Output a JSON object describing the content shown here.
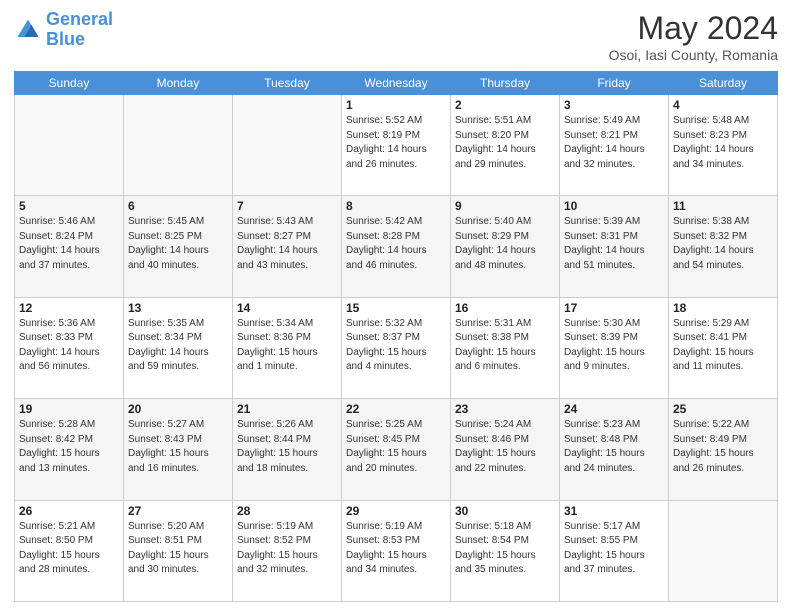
{
  "header": {
    "logo_line1": "General",
    "logo_line2": "Blue",
    "month_year": "May 2024",
    "location": "Osoi, Iasi County, Romania"
  },
  "weekdays": [
    "Sunday",
    "Monday",
    "Tuesday",
    "Wednesday",
    "Thursday",
    "Friday",
    "Saturday"
  ],
  "weeks": [
    [
      {
        "day": "",
        "info": ""
      },
      {
        "day": "",
        "info": ""
      },
      {
        "day": "",
        "info": ""
      },
      {
        "day": "1",
        "info": "Sunrise: 5:52 AM\nSunset: 8:19 PM\nDaylight: 14 hours\nand 26 minutes."
      },
      {
        "day": "2",
        "info": "Sunrise: 5:51 AM\nSunset: 8:20 PM\nDaylight: 14 hours\nand 29 minutes."
      },
      {
        "day": "3",
        "info": "Sunrise: 5:49 AM\nSunset: 8:21 PM\nDaylight: 14 hours\nand 32 minutes."
      },
      {
        "day": "4",
        "info": "Sunrise: 5:48 AM\nSunset: 8:23 PM\nDaylight: 14 hours\nand 34 minutes."
      }
    ],
    [
      {
        "day": "5",
        "info": "Sunrise: 5:46 AM\nSunset: 8:24 PM\nDaylight: 14 hours\nand 37 minutes."
      },
      {
        "day": "6",
        "info": "Sunrise: 5:45 AM\nSunset: 8:25 PM\nDaylight: 14 hours\nand 40 minutes."
      },
      {
        "day": "7",
        "info": "Sunrise: 5:43 AM\nSunset: 8:27 PM\nDaylight: 14 hours\nand 43 minutes."
      },
      {
        "day": "8",
        "info": "Sunrise: 5:42 AM\nSunset: 8:28 PM\nDaylight: 14 hours\nand 46 minutes."
      },
      {
        "day": "9",
        "info": "Sunrise: 5:40 AM\nSunset: 8:29 PM\nDaylight: 14 hours\nand 48 minutes."
      },
      {
        "day": "10",
        "info": "Sunrise: 5:39 AM\nSunset: 8:31 PM\nDaylight: 14 hours\nand 51 minutes."
      },
      {
        "day": "11",
        "info": "Sunrise: 5:38 AM\nSunset: 8:32 PM\nDaylight: 14 hours\nand 54 minutes."
      }
    ],
    [
      {
        "day": "12",
        "info": "Sunrise: 5:36 AM\nSunset: 8:33 PM\nDaylight: 14 hours\nand 56 minutes."
      },
      {
        "day": "13",
        "info": "Sunrise: 5:35 AM\nSunset: 8:34 PM\nDaylight: 14 hours\nand 59 minutes."
      },
      {
        "day": "14",
        "info": "Sunrise: 5:34 AM\nSunset: 8:36 PM\nDaylight: 15 hours\nand 1 minute."
      },
      {
        "day": "15",
        "info": "Sunrise: 5:32 AM\nSunset: 8:37 PM\nDaylight: 15 hours\nand 4 minutes."
      },
      {
        "day": "16",
        "info": "Sunrise: 5:31 AM\nSunset: 8:38 PM\nDaylight: 15 hours\nand 6 minutes."
      },
      {
        "day": "17",
        "info": "Sunrise: 5:30 AM\nSunset: 8:39 PM\nDaylight: 15 hours\nand 9 minutes."
      },
      {
        "day": "18",
        "info": "Sunrise: 5:29 AM\nSunset: 8:41 PM\nDaylight: 15 hours\nand 11 minutes."
      }
    ],
    [
      {
        "day": "19",
        "info": "Sunrise: 5:28 AM\nSunset: 8:42 PM\nDaylight: 15 hours\nand 13 minutes."
      },
      {
        "day": "20",
        "info": "Sunrise: 5:27 AM\nSunset: 8:43 PM\nDaylight: 15 hours\nand 16 minutes."
      },
      {
        "day": "21",
        "info": "Sunrise: 5:26 AM\nSunset: 8:44 PM\nDaylight: 15 hours\nand 18 minutes."
      },
      {
        "day": "22",
        "info": "Sunrise: 5:25 AM\nSunset: 8:45 PM\nDaylight: 15 hours\nand 20 minutes."
      },
      {
        "day": "23",
        "info": "Sunrise: 5:24 AM\nSunset: 8:46 PM\nDaylight: 15 hours\nand 22 minutes."
      },
      {
        "day": "24",
        "info": "Sunrise: 5:23 AM\nSunset: 8:48 PM\nDaylight: 15 hours\nand 24 minutes."
      },
      {
        "day": "25",
        "info": "Sunrise: 5:22 AM\nSunset: 8:49 PM\nDaylight: 15 hours\nand 26 minutes."
      }
    ],
    [
      {
        "day": "26",
        "info": "Sunrise: 5:21 AM\nSunset: 8:50 PM\nDaylight: 15 hours\nand 28 minutes."
      },
      {
        "day": "27",
        "info": "Sunrise: 5:20 AM\nSunset: 8:51 PM\nDaylight: 15 hours\nand 30 minutes."
      },
      {
        "day": "28",
        "info": "Sunrise: 5:19 AM\nSunset: 8:52 PM\nDaylight: 15 hours\nand 32 minutes."
      },
      {
        "day": "29",
        "info": "Sunrise: 5:19 AM\nSunset: 8:53 PM\nDaylight: 15 hours\nand 34 minutes."
      },
      {
        "day": "30",
        "info": "Sunrise: 5:18 AM\nSunset: 8:54 PM\nDaylight: 15 hours\nand 35 minutes."
      },
      {
        "day": "31",
        "info": "Sunrise: 5:17 AM\nSunset: 8:55 PM\nDaylight: 15 hours\nand 37 minutes."
      },
      {
        "day": "",
        "info": ""
      }
    ]
  ]
}
